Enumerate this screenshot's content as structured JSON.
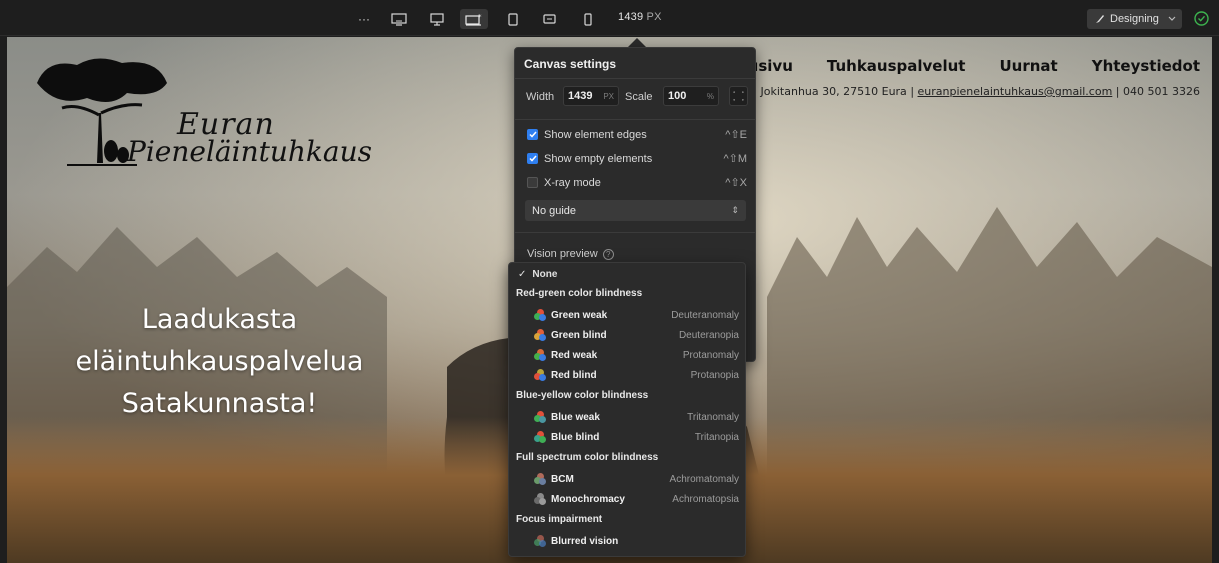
{
  "toolbar": {
    "more_label": "···",
    "width_value": "1439",
    "width_unit": "PX",
    "mode_label": "Designing",
    "colors": {
      "bg": "#1e1e1e",
      "accent_green": "#3db34f"
    }
  },
  "site": {
    "logo_line1": "Euran",
    "logo_line2": "Pieneläintuhkaus",
    "nav": [
      "Etusivu",
      "Tuhkauspalvelut",
      "Uurnat",
      "Yhteystiedot"
    ],
    "contact_address": "Jokitanhua 30, 27510 Eura",
    "contact_email": "euranpienelaintuhkaus@gmail.com",
    "contact_phone": "040 501 3326",
    "contact_separator": "|",
    "hero_lines": [
      "Laadukasta",
      "eläintuhkauspalvelua",
      "Satakunnasta!"
    ]
  },
  "canvas_settings": {
    "title": "Canvas settings",
    "width_label": "Width",
    "width_value": "1439",
    "width_unit": "PX",
    "scale_label": "Scale",
    "scale_value": "100",
    "scale_unit": "%",
    "options": [
      {
        "label": "Show element edges",
        "checked": true,
        "shortcut": "^⇧E"
      },
      {
        "label": "Show empty elements",
        "checked": true,
        "shortcut": "^⇧M"
      },
      {
        "label": "X-ray mode",
        "checked": false,
        "shortcut": "^⇧X"
      }
    ],
    "guide_value": "No guide",
    "vision_label": "Vision preview",
    "help_glyph": "?"
  },
  "vision_menu": {
    "none_label": "None",
    "none_check": "✓",
    "groups": [
      {
        "heading": "Red-green color blindness",
        "items": [
          {
            "name": "Green weak",
            "alt": "Deuteranomaly"
          },
          {
            "name": "Green blind",
            "alt": "Deuteranopia"
          },
          {
            "name": "Red weak",
            "alt": "Protanomaly"
          },
          {
            "name": "Red blind",
            "alt": "Protanopia"
          }
        ]
      },
      {
        "heading": "Blue-yellow color blindness",
        "items": [
          {
            "name": "Blue weak",
            "alt": "Tritanomaly"
          },
          {
            "name": "Blue blind",
            "alt": "Tritanopia"
          }
        ]
      },
      {
        "heading": "Full spectrum color blindness",
        "items": [
          {
            "name": "BCM",
            "alt": "Achromatomaly"
          },
          {
            "name": "Monochromacy",
            "alt": "Achromatopsia"
          }
        ]
      },
      {
        "heading": "Focus impairment",
        "items": [
          {
            "name": "Blurred vision",
            "alt": ""
          }
        ]
      }
    ]
  }
}
